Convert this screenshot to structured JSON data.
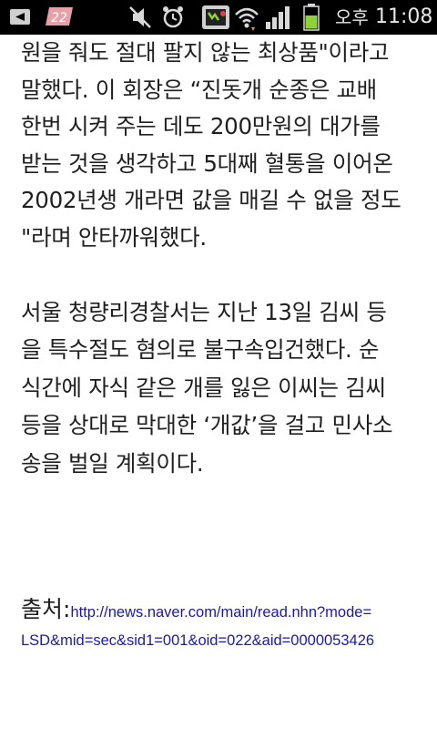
{
  "status_bar": {
    "notification_badge": "22",
    "carrier_label": "오후",
    "clock": "11:08",
    "icons": [
      "usb-icon",
      "notification-badge-icon",
      "mute-icon",
      "alarm-icon",
      "shopping-icon",
      "wifi-icon",
      "signal-icon",
      "battery-icon"
    ]
  },
  "article": {
    "para1": [
      "원을 줘도 절대 팔지 않는 최상품\"이라고",
      "말했다. 이 회장은 “진돗개 순종은 교배",
      "한번 시켜 주는 데도 200만원의 대가를",
      "받는 것을 생각하고 5대째 혈통을 이어온",
      "2002년생 개라면 값을 매길 수 없을 정도",
      "\"라며 안타까워했다."
    ],
    "para2": [
      "서울 청량리경찰서는 지난 13일 김씨 등",
      "을 특수절도 혐의로 불구속입건했다. 순",
      "식간에 자식 같은 개를 잃은 이씨는 김씨",
      "등을 상대로 막대한 ‘개값’을 걸고 민사소",
      "송을 벌일 계획이다."
    ]
  },
  "source": {
    "label": "출처:",
    "link_line1": "http://news.naver.com/main/read.nhn?mode=",
    "link_line2": "LSD&mid=sec&sid1=001&oid=022&aid=0000053426"
  },
  "colors": {
    "status_bar_bg": "#000000",
    "text": "#1f1f1f",
    "link": "#1a1aa6",
    "battery_fill": "#8fd13b",
    "badge": "#e8a0a8"
  }
}
